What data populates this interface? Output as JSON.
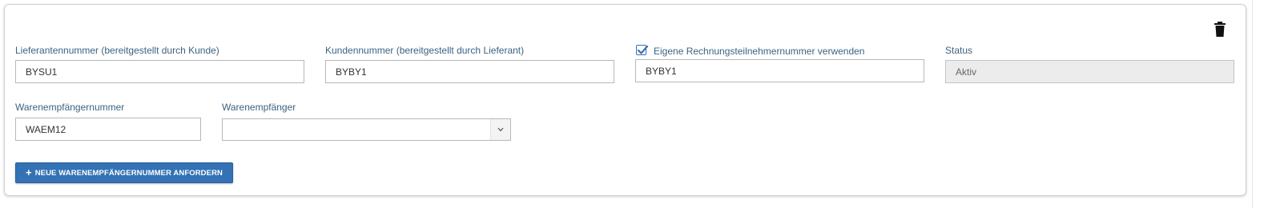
{
  "card": {
    "delete_icon": "trash-icon",
    "fields": {
      "supplier_number": {
        "label": "Lieferantennummer (bereitgestellt durch Kunde)",
        "value": "BYSU1"
      },
      "customer_number": {
        "label": "Kundennummer (bereitgestellt durch Lieferant)",
        "value": "BYBY1"
      },
      "own_invoice_number": {
        "checkbox_label": "Eigene Rechnungsteilnehmernummer verwenden",
        "checked": true,
        "value": "BYBY1"
      },
      "status": {
        "label": "Status",
        "value": "Aktiv"
      },
      "goods_recipient_number": {
        "label": "Warenempfängernummer",
        "value": "WAEM12"
      },
      "goods_recipient": {
        "label": "Warenempfänger",
        "selected": ""
      }
    },
    "request_button": {
      "icon": "plus-icon",
      "label": "NEUE WARENEMPFÄNGERNUMMER ANFORDERN"
    }
  },
  "colors": {
    "label": "#3c6381",
    "button": "#3372b4",
    "checkbox": "#3a6fb5",
    "disabled_field": "#ececec"
  }
}
